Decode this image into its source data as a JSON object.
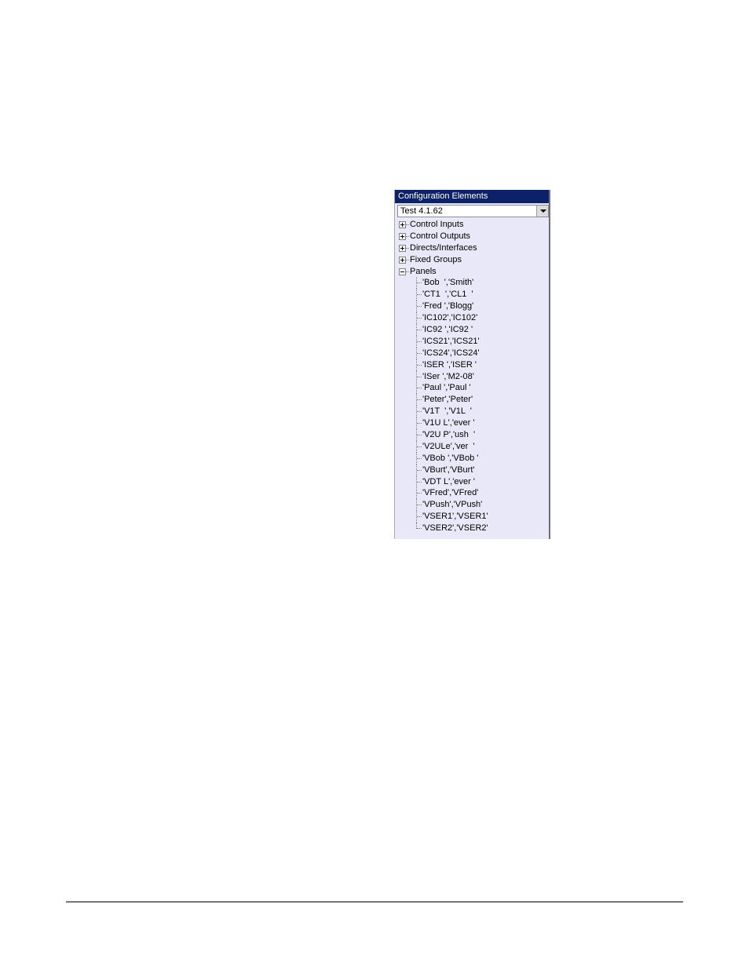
{
  "panel": {
    "title": "Configuration Elements",
    "dropdown": {
      "selected": "Test 4.1.62",
      "button_icon": "dropdown-arrow-icon"
    },
    "tree": {
      "collapsed": [
        {
          "label": "Control Inputs",
          "icon": "expand-plus-icon"
        },
        {
          "label": "Control Outputs",
          "icon": "expand-plus-icon"
        },
        {
          "label": "Directs/Interfaces",
          "icon": "expand-plus-icon"
        },
        {
          "label": "Fixed Groups",
          "icon": "expand-plus-icon"
        }
      ],
      "expanded": {
        "label": "Panels",
        "icon": "collapse-minus-icon",
        "children": [
          "'Bob  ','Smith'",
          "'CT1  ','CL1  '",
          "'Fred ','Blogg'",
          "'IC102','IC102'",
          "'IC92 ','IC92 '",
          "'ICS21','ICS21'",
          "'ICS24','ICS24'",
          "'ISER ','ISER '",
          "'ISer ','M2-08'",
          "'Paul ','Paul '",
          "'Peter','Peter'",
          "'V1T  ','V1L  '",
          "'V1U L','ever '",
          "'V2U P','ush  '",
          "'V2ULe','ver  '",
          "'VBob ','VBob '",
          "'VBurt','VBurt'",
          "'VDT L','ever '",
          "'VFred','VFred'",
          "'VPush','VPush'",
          "'VSER1','VSER1'",
          "'VSER2','VSER2'"
        ]
      }
    }
  },
  "colors": {
    "header_bg": "#0c2168",
    "panel_bg": "#e8e8f8"
  }
}
